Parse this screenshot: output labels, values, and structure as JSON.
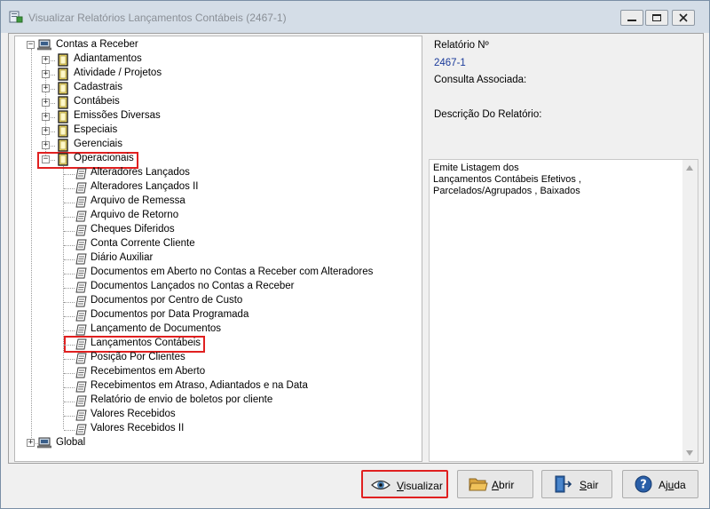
{
  "window": {
    "title": "Visualizar Relatórios Lançamentos Contábeis (2467-1)"
  },
  "tree": {
    "root": {
      "label": "Contas a Receber",
      "children": [
        {
          "label": "Adiantamentos"
        },
        {
          "label": "Atividade / Projetos"
        },
        {
          "label": "Cadastrais"
        },
        {
          "label": "Contábeis"
        },
        {
          "label": "Emissões Diversas"
        },
        {
          "label": "Especiais"
        },
        {
          "label": "Gerenciais"
        },
        {
          "label": "Operacionais"
        }
      ]
    },
    "operacionais_items": [
      "Alteradores  Lançados",
      "Alteradores  Lançados II",
      "Arquivo de Remessa",
      "Arquivo de Retorno",
      "Cheques Diferidos",
      "Conta Corrente Cliente",
      "Diário  Auxiliar",
      "Documentos em Aberto no Contas a Receber com Alteradores",
      "Documentos Lançados no Contas a Receber",
      "Documentos por Centro de Custo",
      "Documentos por Data Programada",
      "Lançamento  de Documentos",
      "Lançamentos Contábeis",
      "Posição Por Clientes",
      "Recebimentos em Aberto",
      "Recebimentos em Atraso, Adiantados e na Data",
      "Relatório de envio de boletos por cliente",
      "Valores Recebidos",
      "Valores Recebidos II"
    ],
    "global_label": "Global",
    "expanded_symbol": "−",
    "collapsed_symbol": "+"
  },
  "details": {
    "report_number_label": "Relatório Nº",
    "report_number_value": "2467-1",
    "query_label": "Consulta Associada:",
    "description_label": "Descrição Do Relatório:",
    "description_lines": [
      "Emite Listagem dos",
      "Lançamentos Contábeis Efetivos ,",
      "Parcelados/Agrupados , Baixados"
    ]
  },
  "buttons": {
    "visualizar": {
      "prefix": "",
      "underline": "V",
      "rest": "isualizar"
    },
    "abrir": {
      "prefix": "",
      "underline": "A",
      "rest": "brir"
    },
    "sair": {
      "prefix": "",
      "underline": "S",
      "rest": "air"
    },
    "ajuda": {
      "prefix": "Aj",
      "underline": "u",
      "rest": "da"
    }
  },
  "colors": {
    "highlight_border": "#e02020",
    "link_value": "#1a3a9a",
    "folder_fill": "#f7e06a"
  },
  "icons": {
    "app": "report-app-icon",
    "computer": "computer-icon",
    "folder": "folder-icon",
    "document": "document-icon",
    "eye": "eye-icon",
    "open_folder": "open-folder-icon",
    "exit": "exit-door-icon",
    "help": "help-question-icon"
  }
}
